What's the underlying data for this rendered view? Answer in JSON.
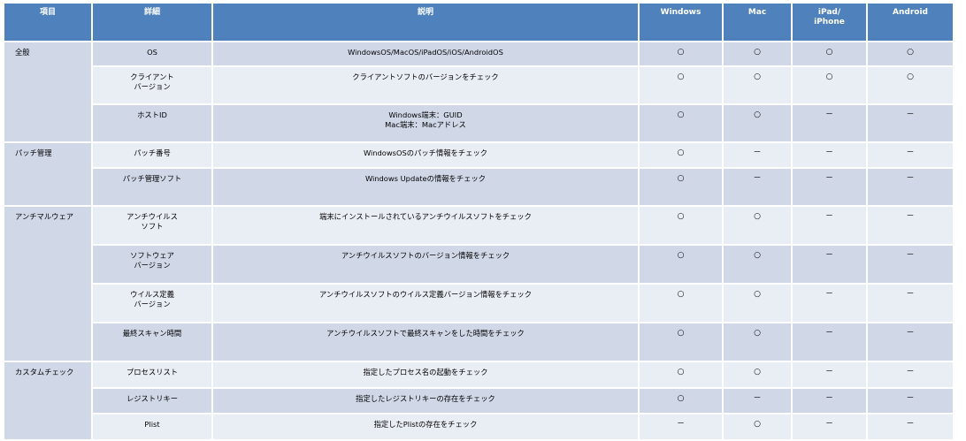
{
  "headers": [
    "項目",
    "詳細",
    "説明",
    "Windows",
    "Mac",
    "iPad/\niPhone",
    "Android"
  ],
  "groups": [
    {
      "category": "全般",
      "rows": [
        {
          "detail": "OS",
          "desc": "WindowsOS/MacOS/iPadOS/iOS/AndroidOS",
          "win": "○",
          "mac": "○",
          "ipad": "○",
          "android": "○"
        },
        {
          "detail": "クライアント\nバージョン",
          "desc": "クライアントソフトのバージョンをチェック",
          "win": "○",
          "mac": "○",
          "ipad": "○",
          "android": "○"
        },
        {
          "detail": "ホストID",
          "desc": "Windows端末：GUID\nMac端末：Macアドレス",
          "win": "○",
          "mac": "○",
          "ipad": "－",
          "android": "－"
        }
      ]
    },
    {
      "category": "パッチ管理",
      "rows": [
        {
          "detail": "パッチ番号",
          "desc": "WindowsOSのパッチ情報をチェック",
          "win": "○",
          "mac": "－",
          "ipad": "－",
          "android": "－"
        },
        {
          "detail": "パッチ管理ソフト",
          "desc": "Windows Updateの情報をチェック",
          "win": "○",
          "mac": "－",
          "ipad": "－",
          "android": "－"
        }
      ]
    },
    {
      "category": "アンチマルウェア",
      "rows": [
        {
          "detail": "アンチウイルス\nソフト",
          "desc": "端末にインストールされているアンチウイルスソフトをチェック",
          "win": "○",
          "mac": "○",
          "ipad": "－",
          "android": "－"
        },
        {
          "detail": "ソフトウェア\nバージョン",
          "desc": "アンチウイルスソフトのバージョン情報をチェック",
          "win": "○",
          "mac": "○",
          "ipad": "－",
          "android": "－"
        },
        {
          "detail": "ウイルス定義\nバージョン",
          "desc": "アンチウイルスソフトのウイルス定義バージョン情報をチェック",
          "win": "○",
          "mac": "○",
          "ipad": "－",
          "android": "－"
        },
        {
          "detail": "最終スキャン時間",
          "desc": "アンチウイルスソフトで最終スキャンをした時間をチェック",
          "win": "○",
          "mac": "○",
          "ipad": "－",
          "android": "－"
        }
      ]
    },
    {
      "category": "カスタムチェック",
      "rows": [
        {
          "detail": "プロセスリスト",
          "desc": "指定したプロセス名の起動をチェック",
          "win": "○",
          "mac": "○",
          "ipad": "－",
          "android": "－"
        },
        {
          "detail": "レジストリキー",
          "desc": "指定したレジストリキーの存在をチェック",
          "win": "○",
          "mac": "－",
          "ipad": "－",
          "android": "－"
        },
        {
          "detail": "Plist",
          "desc": "指定したPlistの存在をチェック",
          "win": "－",
          "mac": "○",
          "ipad": "－",
          "android": "－"
        }
      ]
    }
  ]
}
